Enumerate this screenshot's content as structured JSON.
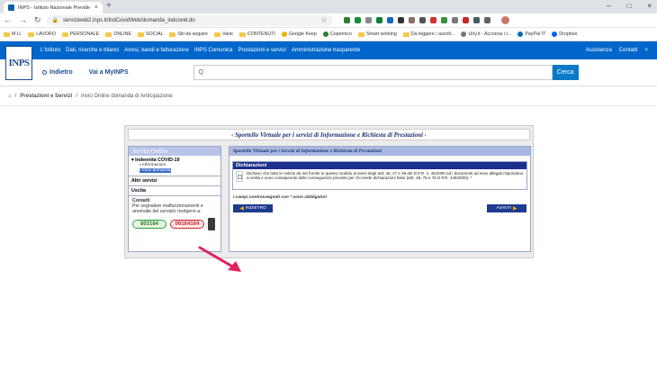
{
  "browser": {
    "tab_title": "INPS - Istituto Nazionale Previde",
    "url": "serviziweb2.inps.it/IndCovidWeb/domanda_indcovid.do",
    "bookmarks": [
      "M.U.",
      "LAVORO",
      "PERSONALE",
      "ONLINE",
      "SOCIAL",
      "Siti da seguire",
      "Varie",
      "CONTENUTI",
      "Google Keep",
      "Copernico",
      "Smart working",
      "Da leggere / ascolt...",
      "Urly.it - Accorcia i t...",
      "PayPal IT",
      "Dropbox"
    ]
  },
  "site": {
    "logo": "INPS",
    "top_menu": [
      "L'Istituto",
      "Dati, ricerche e bilanci",
      "Avvisi, bandi e fatturazione",
      "INPS Comunica",
      "Prestazioni e servizi",
      "Amministrazione trasparente"
    ],
    "top_right": [
      "Assistenza",
      "Contatti"
    ],
    "back_label": "Indietro",
    "myinps_label": "Vai a MyINPS",
    "search_placeholder": "Q",
    "search_button": "Cerca"
  },
  "breadcrumb": {
    "level1": "Prestazioni e Servizi",
    "level2": "Invio Online domanda di Anticipazione"
  },
  "panel": {
    "title": "‹  Sportello Virtuale per i servizi di Informazione e Richiesta di Prestazioni  ›",
    "sidebar": {
      "header": "Servizi Online",
      "section1": "▾ Indennità COVID-19",
      "sub1": "▪ Informazioni",
      "sub2": "▪ Invio domanda",
      "section2": "Altri servizi",
      "section3": "Uscita",
      "contatti_title": "Contatti",
      "contatti_text": "Per segnalare malfunzionamenti e anomalie del servizio rivolgersi a:",
      "phone1": "803164",
      "phone2": "06164164"
    },
    "main": {
      "header": "Sportello Virtuale per i Servizi di Informazione e Richiesta di Prestazioni",
      "dich_title": "Dichiarazioni",
      "dich_text": "Dichiaro che tutte le notizie da me fornite in questo modulo ai sensi degli artt. 46, 47 e 48 del D.P.R. n. 45/2000 ed i documenti ad esso allegati rispondono a verità e sono consapevole delle conseguenze previste per chi rende dichiarazioni false (artt. 48, 75 e 76 D.P.R. 445/2000). *",
      "required_note": "I campi contrassegnati con",
      "required_star": "*",
      "required_note2": "sono obbligatori",
      "back_btn": "INDIETRO",
      "next_btn": "AVANTI"
    }
  },
  "colors": {
    "brand_blue": "#0066cc",
    "arrow_pink": "#e0245e"
  }
}
